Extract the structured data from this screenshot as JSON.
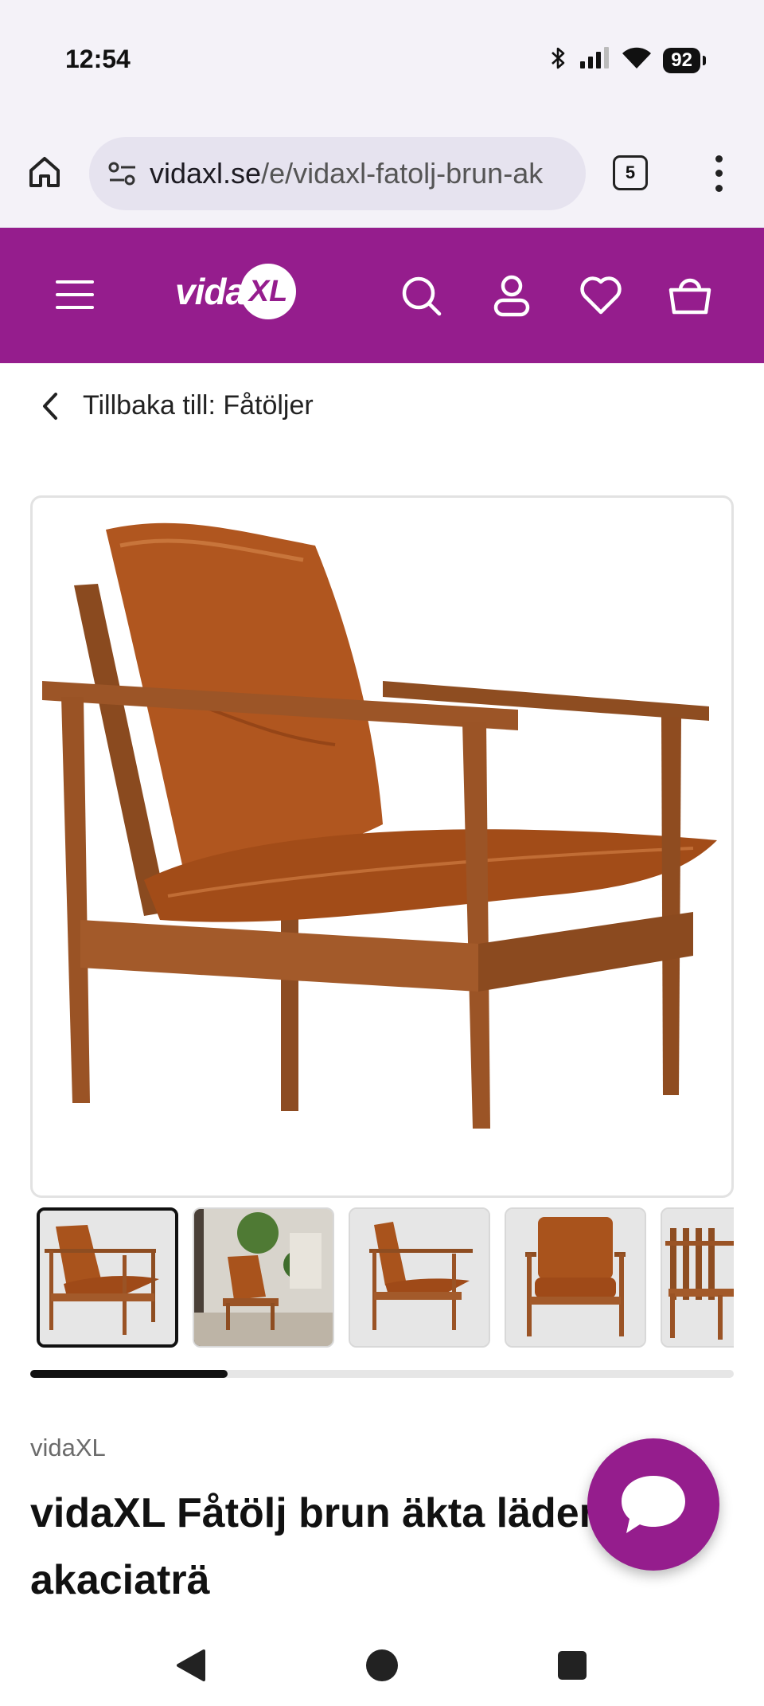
{
  "status_bar": {
    "time": "12:54",
    "battery": "92",
    "icons": [
      "bluetooth-icon",
      "signal-icon",
      "wifi-icon",
      "battery-icon"
    ]
  },
  "browser": {
    "url_domain": "vidaxl.se",
    "url_path": "/e/vidaxl-fatolj-brun-ak",
    "tab_count": "5"
  },
  "header": {
    "logo_text": "vida",
    "logo_badge": "XL",
    "brand_color": "#951d8d",
    "icons": [
      "menu-icon",
      "search-icon",
      "account-icon",
      "wishlist-icon",
      "cart-icon"
    ]
  },
  "breadcrumb": {
    "text": "Tillbaka till: Fåtöljer"
  },
  "gallery": {
    "thumbnail_count": 5,
    "active_index": 0,
    "scroll_progress": 0.28
  },
  "product": {
    "brand": "vidaXL",
    "title": "vidaXL Fåtölj brun äkta läder akaciaträ"
  },
  "navigation": {
    "icons": [
      "back-icon",
      "home-icon",
      "recents-icon"
    ]
  }
}
